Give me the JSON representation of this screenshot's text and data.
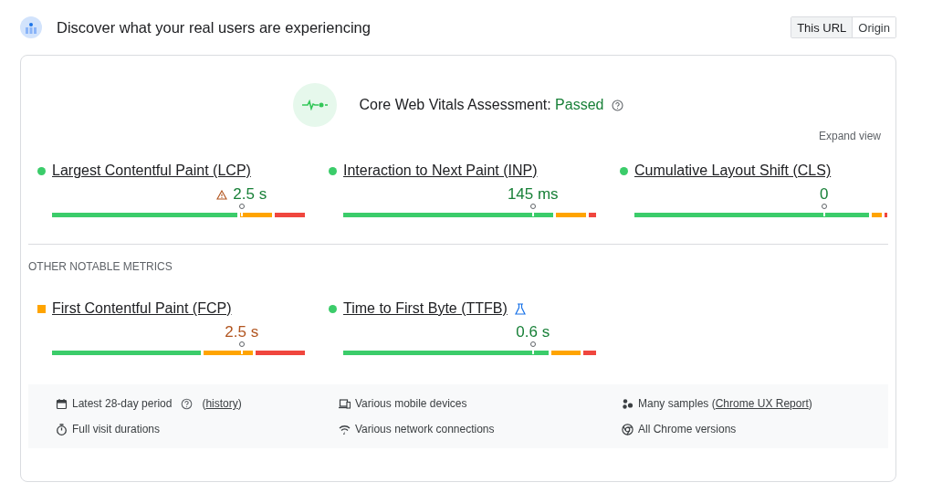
{
  "header": {
    "title": "Discover what your real users are experiencing"
  },
  "scope_toggle": [
    {
      "label": "This URL",
      "selected": true
    },
    {
      "label": "Origin",
      "selected": false
    }
  ],
  "assessment": {
    "label": "Core Web Vitals Assessment: ",
    "result": "Passed"
  },
  "expand_link": "Expand view",
  "core_metrics": [
    {
      "name": "Largest Contentful Paint (LCP)",
      "kind": "good",
      "value": "2.5 s",
      "warning": true,
      "experimental": false
    },
    {
      "name": "Interaction to Next Paint (INP)",
      "kind": "good",
      "value": "145 ms",
      "warning": false,
      "experimental": false
    },
    {
      "name": "Cumulative Layout Shift (CLS)",
      "kind": "good",
      "value": "0",
      "warning": false,
      "experimental": false
    }
  ],
  "other_heading": "OTHER NOTABLE METRICS",
  "other_metrics": [
    {
      "name": "First Contentful Paint (FCP)",
      "kind": "average",
      "value": "2.5 s",
      "warning": false,
      "experimental": false
    },
    {
      "name": "Time to First Byte (TTFB)",
      "kind": "good",
      "value": "0.6 s",
      "warning": false,
      "experimental": true
    }
  ],
  "footer_items": [
    {
      "text": "Latest 28-day period",
      "help": true,
      "pre": "(",
      "link": "history",
      "after": ")"
    },
    {
      "text": "Various mobile devices"
    },
    {
      "text": "Many samples (",
      "link": "Chrome UX Report",
      "after": ")"
    },
    {
      "text": "Full visit durations"
    },
    {
      "text": "Various network connections"
    },
    {
      "text": "All Chrome versions"
    }
  ]
}
